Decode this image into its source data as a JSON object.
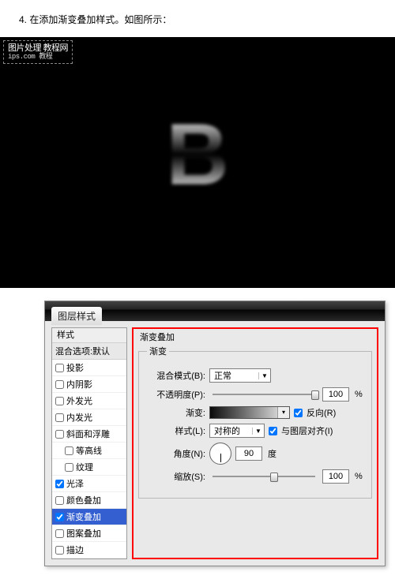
{
  "step": "4. 在添加渐变叠加样式。如图所示：",
  "watermark": {
    "line1": "图片处理 教程网",
    "line2": "ips.com 教程"
  },
  "preview_letter": "B",
  "dialog": {
    "title": "图层样式",
    "styles_header": "样式",
    "blend_defaults": "混合选项:默认",
    "items": [
      {
        "label": "投影",
        "checked": false,
        "sub": false
      },
      {
        "label": "内阴影",
        "checked": false,
        "sub": false
      },
      {
        "label": "外发光",
        "checked": false,
        "sub": false
      },
      {
        "label": "内发光",
        "checked": false,
        "sub": false
      },
      {
        "label": "斜面和浮雕",
        "checked": false,
        "sub": false
      },
      {
        "label": "等高线",
        "checked": false,
        "sub": true
      },
      {
        "label": "纹理",
        "checked": false,
        "sub": true
      },
      {
        "label": "光泽",
        "checked": true,
        "sub": false
      },
      {
        "label": "颜色叠加",
        "checked": false,
        "sub": false
      },
      {
        "label": "渐变叠加",
        "checked": true,
        "sub": false,
        "selected": true
      },
      {
        "label": "图案叠加",
        "checked": false,
        "sub": false
      },
      {
        "label": "描边",
        "checked": false,
        "sub": false
      }
    ],
    "panel": {
      "heading": "渐变叠加",
      "legend": "渐变",
      "blendmode_label": "混合模式(B):",
      "blendmode_value": "正常",
      "opacity_label": "不透明度(P):",
      "opacity_value": "100",
      "opacity_unit": "%",
      "gradient_label": "渐变:",
      "reverse_label": "反向(R)",
      "reverse_checked": true,
      "style_label": "样式(L):",
      "style_value": "对称的",
      "align_label": "与图层对齐(I)",
      "align_checked": true,
      "angle_label": "角度(N):",
      "angle_value": "90",
      "angle_unit": "度",
      "scale_label": "缩放(S):",
      "scale_value": "100",
      "scale_unit": "%"
    }
  }
}
